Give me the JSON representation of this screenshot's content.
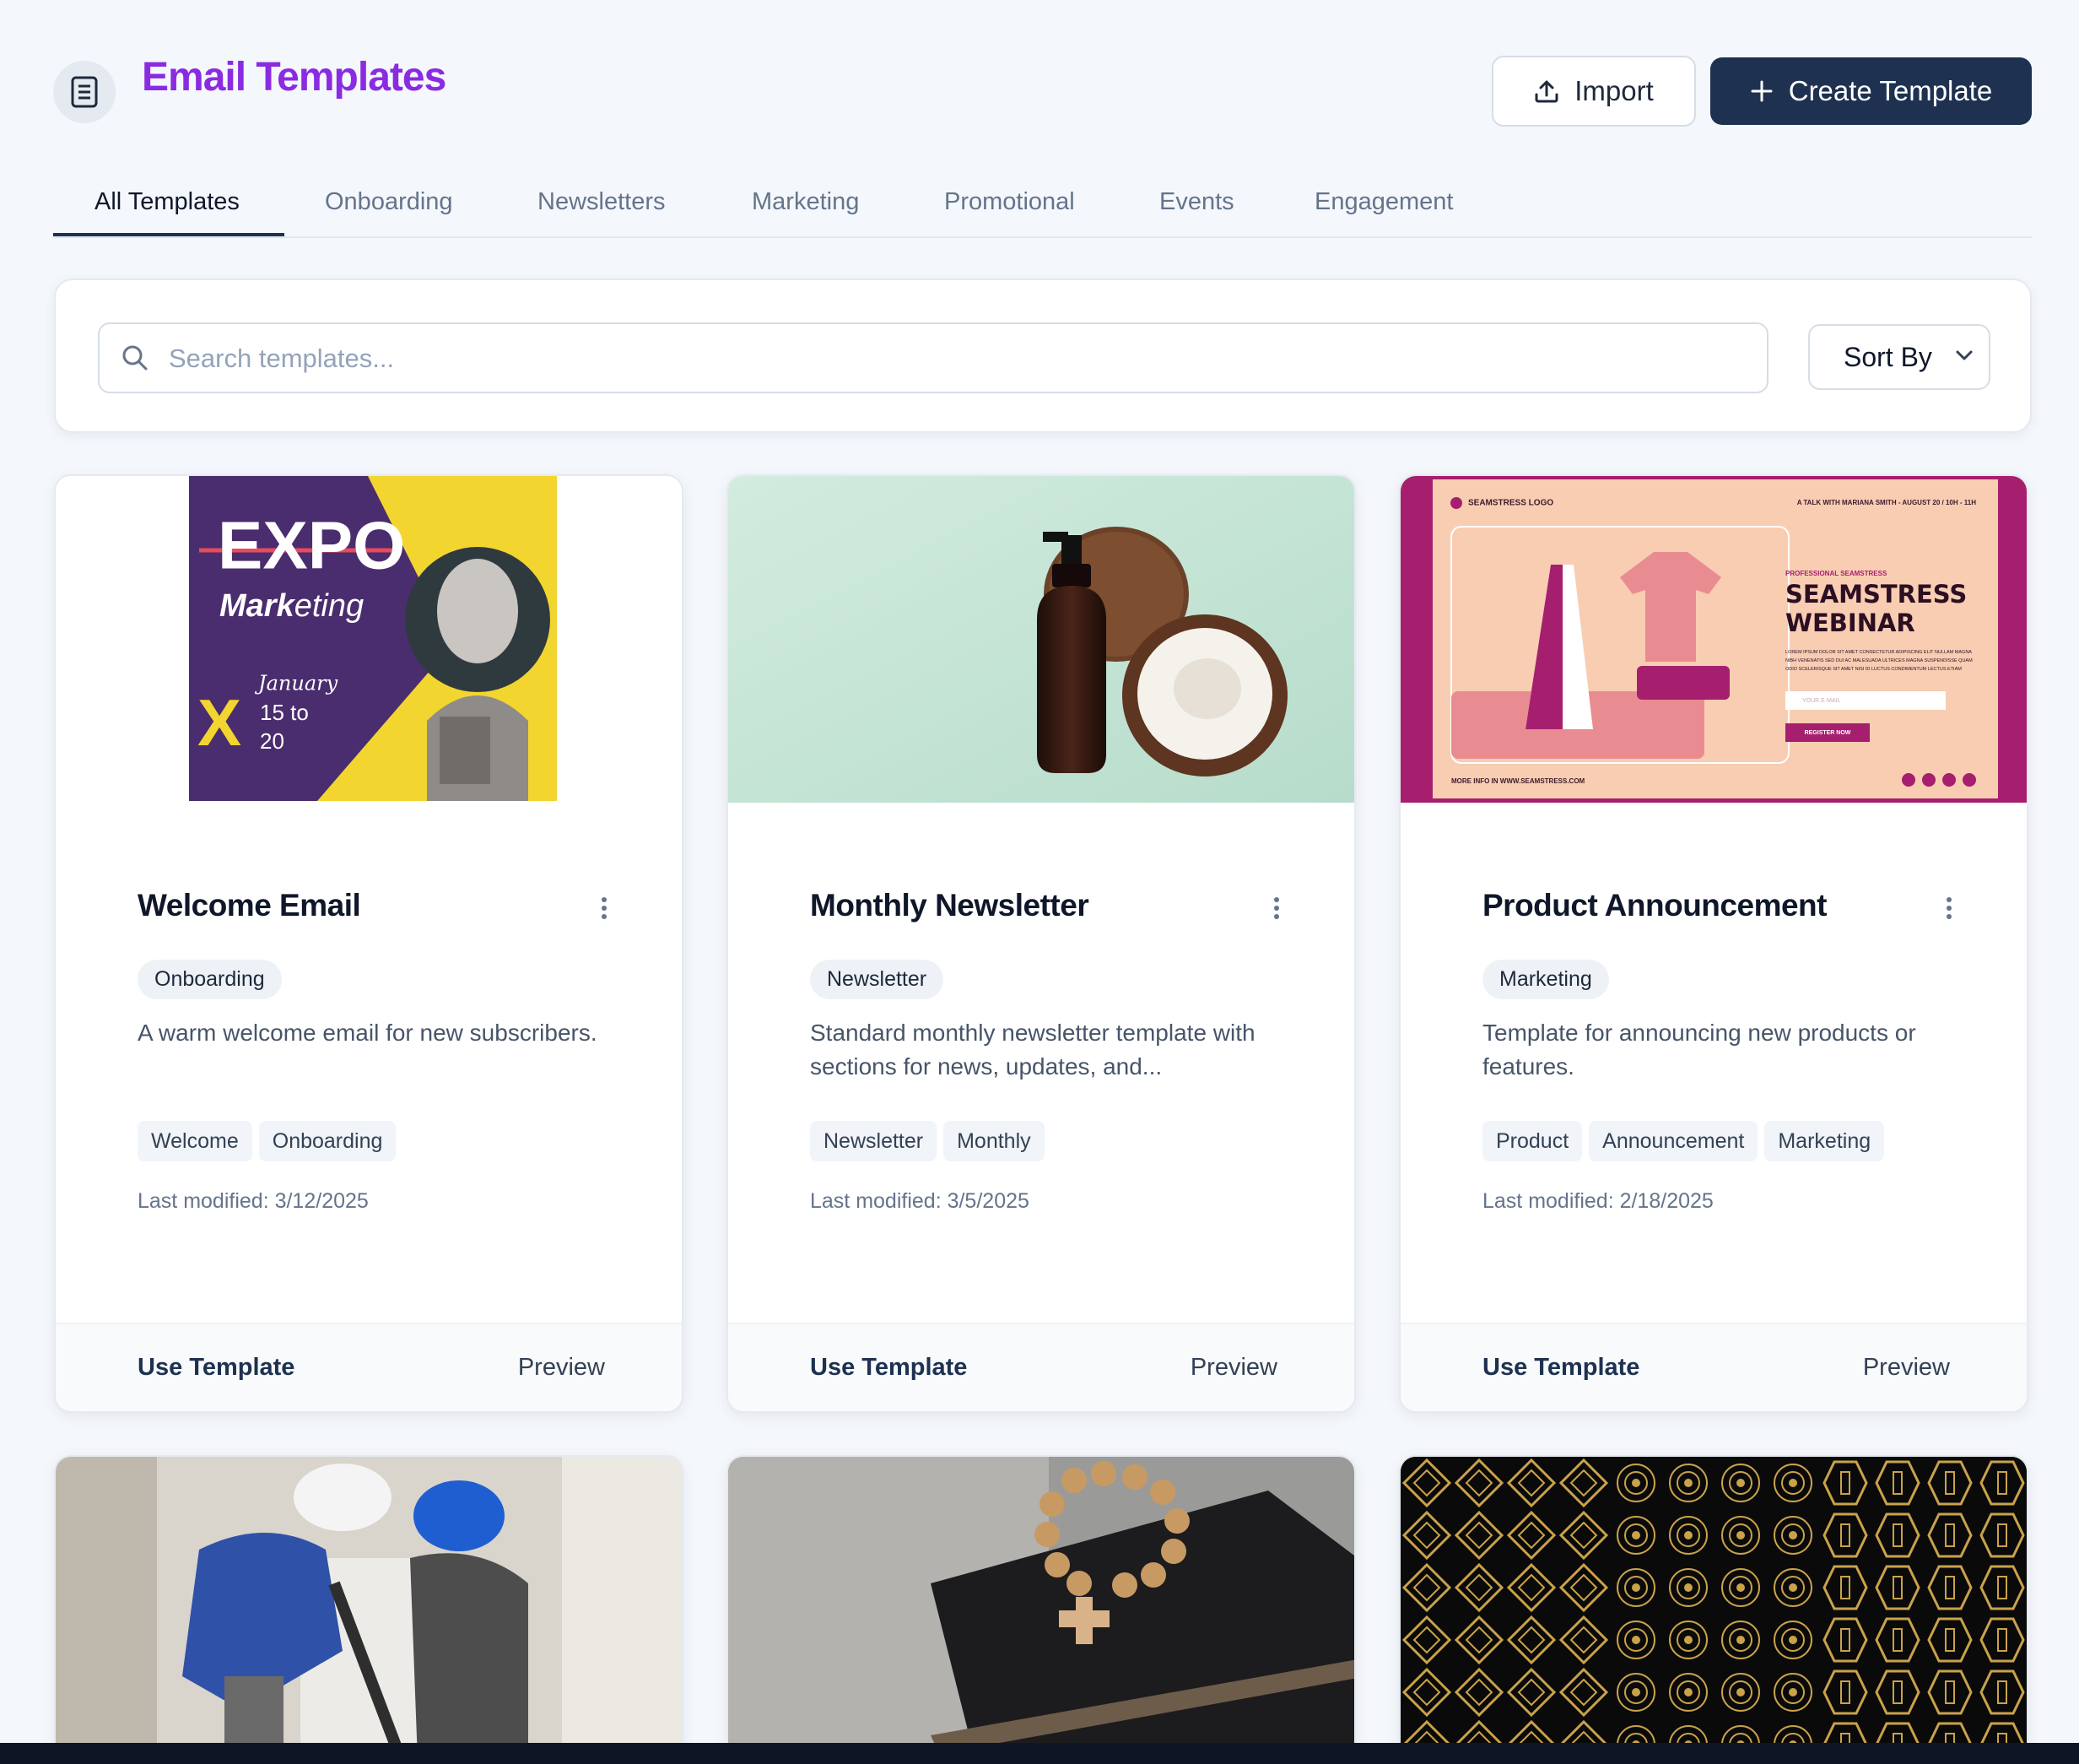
{
  "header": {
    "title": "Email Templates",
    "import_label": "Import",
    "create_label": "Create Template"
  },
  "tabs": [
    {
      "label": "All Templates",
      "active": true
    },
    {
      "label": "Onboarding"
    },
    {
      "label": "Newsletters"
    },
    {
      "label": "Marketing"
    },
    {
      "label": "Promotional"
    },
    {
      "label": "Events"
    },
    {
      "label": "Engagement"
    }
  ],
  "search": {
    "placeholder": "Search templates...",
    "value": ""
  },
  "sort": {
    "label": "Sort By"
  },
  "cards": [
    {
      "title": "Welcome Email",
      "category": "Onboarding",
      "description": "A warm welcome email for new subscribers.",
      "tags": [
        "Welcome",
        "Onboarding"
      ],
      "last_modified": "Last modified: 3/12/2025",
      "use_label": "Use Template",
      "preview_label": "Preview",
      "thumb": {
        "line1": "EXPO",
        "line2a": "Mark",
        "line2b": "eting",
        "x_mark": "X",
        "date1": "January",
        "date2": "15 to",
        "date3": "20"
      }
    },
    {
      "title": "Monthly Newsletter",
      "category": "Newsletter",
      "description": "Standard monthly newsletter template with sections for news, updates, and...",
      "tags": [
        "Newsletter",
        "Monthly"
      ],
      "last_modified": "Last modified: 3/5/2025",
      "use_label": "Use Template",
      "preview_label": "Preview"
    },
    {
      "title": "Product Announcement",
      "category": "Marketing",
      "description": "Template for announcing new products or features.",
      "tags": [
        "Product",
        "Announcement",
        "Marketing"
      ],
      "last_modified": "Last modified: 2/18/2025",
      "use_label": "Use Template",
      "preview_label": "Preview",
      "thumb": {
        "logo": "SEAMSTRESS LOGO",
        "talk": "A TALK WITH MARIANA SMITH - AUGUST 20 / 10H - 11H",
        "kicker": "PROFESSIONAL SEAMSTRESS",
        "headline1": "SEAMSTRESS",
        "headline2": "WEBINAR",
        "body1": "LOREM IPSUM DOLOR SIT AMET CONSECTETUR ADIPISCING ELIT NULLAM MAGNA",
        "body2": "NIBH VENENATIS SED DUI AC MALESUADA ULTRICES MAGNA SUSPENDISSE QUAM",
        "body3": "ODIO SCELERISQUE SIT AMET NISI ID LUCTUS CONDIMENTUM LECTUS ETIAM",
        "email_placeholder": "YOUR E-MAIL",
        "register": "REGISTER NOW",
        "more_info": "MORE INFO IN WWW.SEAMSTRESS.COM"
      }
    }
  ],
  "colors": {
    "title_accent": "#8a2be2",
    "primary": "#1e3150",
    "expo_purple": "#4a2d6e",
    "expo_yellow": "#f3d530",
    "newsletter_mint": "#c7e6d8",
    "seamstress_magenta": "#a61f6e",
    "seamstress_peach": "#f8cdb2"
  }
}
